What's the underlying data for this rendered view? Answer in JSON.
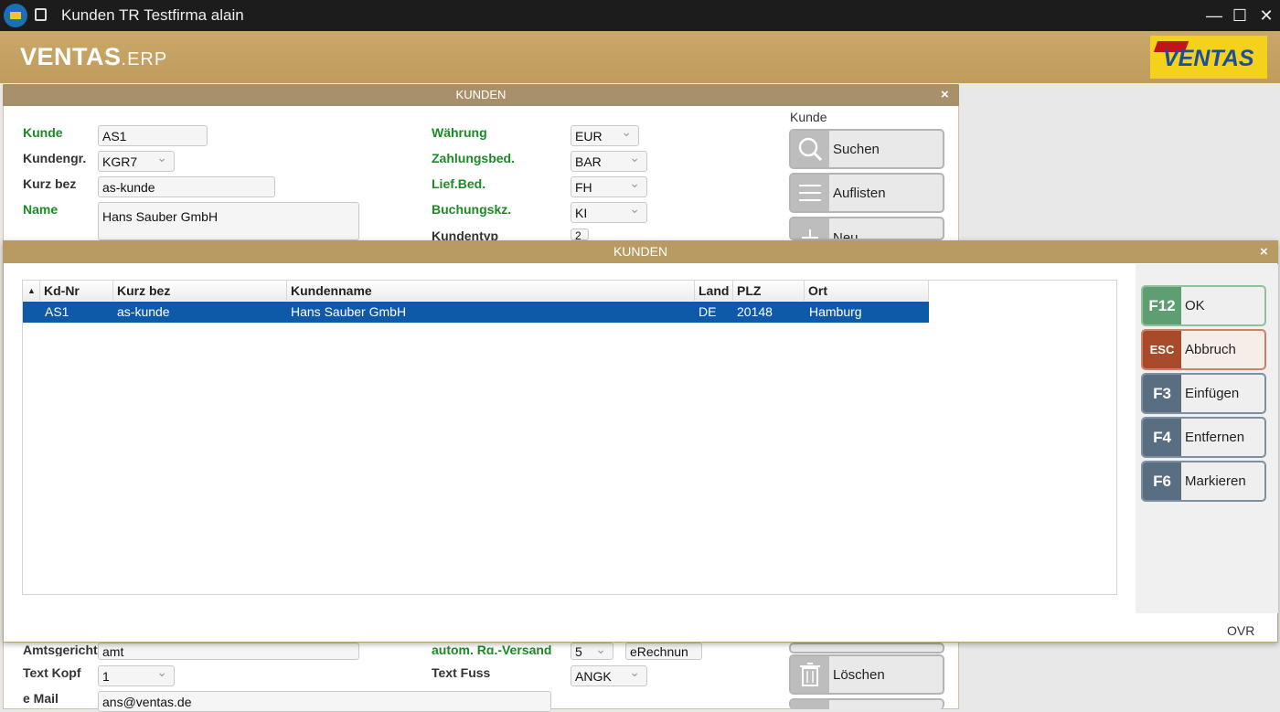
{
  "window": {
    "title": "Kunden TR Testfirma alain",
    "minimize": "—",
    "maximize": "☐",
    "close": "✕"
  },
  "header": {
    "brand": "VENTAS",
    "brand_suffix": ".ERP",
    "logo_text": "VENTAS"
  },
  "back_form": {
    "title": "KUNDEN",
    "close": "×",
    "fields": {
      "kunde_label": "Kunde",
      "kunde_value": "AS1",
      "kundengr_label": "Kundengr.",
      "kundengr_value": "KGR7",
      "kurzbez_label": "Kurz bez",
      "kurzbez_value": "as-kunde",
      "name_label": "Name",
      "name_value": "Hans Sauber GmbH",
      "waehrung_label": "Währung",
      "waehrung_value": "EUR",
      "zahlungsbed_label": "Zahlungsbed.",
      "zahlungsbed_value": "BAR",
      "liefbed_label": "Lief.Bed.",
      "liefbed_value": "FH",
      "buchungskz_label": "Buchungskz.",
      "buchungskz_value": "KI",
      "kundentyp_label": "Kundentyp",
      "kundentyp_value": "2",
      "amtsgericht_label": "Amtsgericht",
      "amtsgericht_value": "amt",
      "textkopf_label": "Text Kopf",
      "textkopf_value": "1",
      "email_label": "e Mail",
      "email_value": "ans@ventas.de",
      "rgversand_label": "autom. Rg.-Versand",
      "rgversand_value": "5",
      "erechnung_value": "eRechnun",
      "textfuss_label": "Text Fuss",
      "textfuss_value": "ANGK"
    },
    "side_group_label": "Kunde",
    "side_buttons": {
      "suchen": "Suchen",
      "auflisten": "Auflisten",
      "neu": "Neu",
      "loeschen": "Löschen"
    }
  },
  "dialog": {
    "title": "KUNDEN",
    "close": "×",
    "sort_indicator": "▲",
    "columns": [
      "Kd-Nr",
      "Kurz bez",
      "Kundenname",
      "Land",
      "PLZ",
      "Ort"
    ],
    "rows": [
      {
        "kdnr": "AS1",
        "kurzbez": "as-kunde",
        "kundenname": "Hans Sauber GmbH",
        "land": "DE",
        "plz": "20148",
        "ort": "Hamburg"
      }
    ],
    "buttons": [
      {
        "key": "F12",
        "label": "OK"
      },
      {
        "key": "ESC",
        "label": "Abbruch"
      },
      {
        "key": "F3",
        "label": "Einfügen"
      },
      {
        "key": "F4",
        "label": "Entfernen"
      },
      {
        "key": "F6",
        "label": "Markieren"
      }
    ],
    "status": "OVR"
  },
  "colors": {
    "header_gold": "#c9a86a",
    "selection_blue": "#0f5aa8",
    "label_green": "#1b8a24",
    "ok_green": "#5f9e73",
    "esc_rust": "#a94a2a",
    "key_slate": "#5a6e82"
  }
}
